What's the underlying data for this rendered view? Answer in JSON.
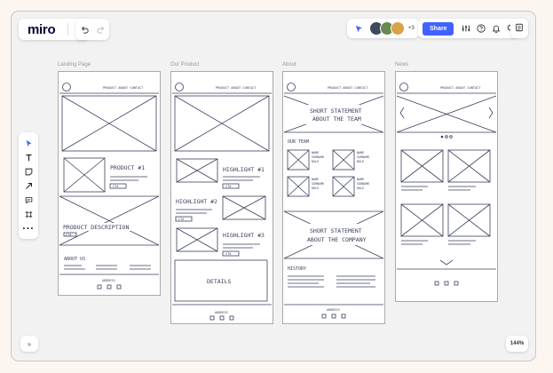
{
  "app": {
    "logo": "miro"
  },
  "toolbar": {
    "share_label": "Share",
    "collaborators_more": "+3",
    "zoom_level": "144%"
  },
  "frames": {
    "landing": {
      "label": "Landing Page",
      "nav": "PRODUCT  ABOUT  CONTACT",
      "product_title": "PRODUCT #1",
      "cta": "CTA",
      "description": "PRODUCT DESCRIPTION",
      "about": "ABOUT US",
      "address": "ADDRESS"
    },
    "product": {
      "label": "Our Product",
      "nav": "PRODUCT  ABOUT  CONTACT",
      "h1": "HIGHLIGHT #1",
      "h2": "HIGHLIGHT #2",
      "h3": "HIGHLIGHT #3",
      "cta": "CTA",
      "details": "DETAILS",
      "address": "ADDRESS"
    },
    "about": {
      "label": "About",
      "nav": "PRODUCT  ABOUT  CONTACT",
      "statement1_a": "SHORT STATEMENT",
      "statement1_b": "ABOUT THE TEAM",
      "team": "OUR TEAM",
      "member_a": "NAME",
      "member_b": "SURNAME",
      "member_c": "ROLE",
      "statement2_a": "SHORT STATEMENT",
      "statement2_b": "ABOUT THE COMPANY",
      "history": "HISTORY",
      "address": "ADDRESS"
    },
    "news": {
      "label": "News",
      "nav": "PRODUCT  ABOUT  CONTACT"
    }
  },
  "icons": {
    "upload": "upload-icon",
    "undo": "undo-icon",
    "redo": "redo-icon",
    "cursor": "cursor-icon",
    "text": "text-icon",
    "sticky": "sticky-note-icon",
    "arrow": "arrow-icon",
    "comment": "comment-icon",
    "frame": "frame-icon",
    "more": "more-icon",
    "settings": "settings-icon",
    "help": "help-icon",
    "bell": "bell-icon",
    "search": "search-icon",
    "notes": "notes-icon",
    "collapse": "collapse-icon"
  },
  "colors": {
    "accent": "#4262ff",
    "sketch": "#3a3f5c",
    "board": "#f2f2f2",
    "background": "#fbf6f0"
  }
}
